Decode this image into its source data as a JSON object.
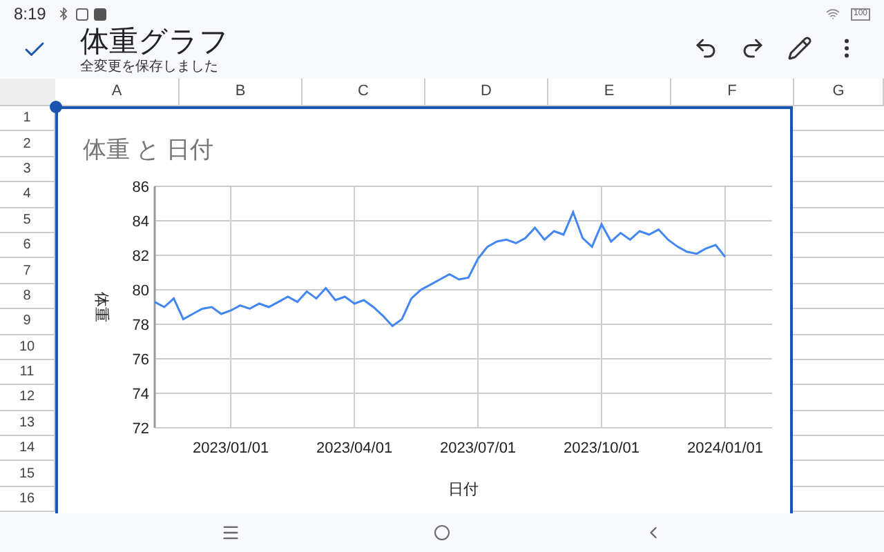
{
  "status_bar": {
    "time": "8:19",
    "battery": "100"
  },
  "toolbar": {
    "title": "体重グラフ",
    "subtitle": "全変更を保存しました"
  },
  "columns": [
    "A",
    "B",
    "C",
    "D",
    "E",
    "F",
    "G"
  ],
  "rows": [
    "1",
    "2",
    "3",
    "4",
    "5",
    "6",
    "7",
    "8",
    "9",
    "10",
    "11",
    "12",
    "13",
    "14",
    "15",
    "16"
  ],
  "chart": {
    "chart_data": {
      "type": "line",
      "title": "体重 と 日付",
      "xlabel": "日付",
      "ylabel": "体重",
      "categories": [
        null,
        null,
        null,
        null,
        null,
        null,
        null,
        null,
        "2023/01/01",
        null,
        null,
        null,
        null,
        null,
        null,
        null,
        null,
        null,
        null,
        null,
        null,
        "2023/04/01",
        null,
        null,
        null,
        null,
        null,
        null,
        null,
        null,
        null,
        null,
        null,
        null,
        "2023/07/01",
        null,
        null,
        null,
        null,
        null,
        null,
        null,
        null,
        null,
        null,
        null,
        null,
        "2023/10/01",
        null,
        null,
        null,
        null,
        null,
        null,
        null,
        null,
        null,
        null,
        null,
        null,
        "2024/01/01"
      ],
      "grid": true,
      "series": [
        {
          "color": "#4285f4",
          "values": [
            79.3,
            79.0,
            79.5,
            78.3,
            78.6,
            78.9,
            79.0,
            78.6,
            78.8,
            79.1,
            78.9,
            79.2,
            79.0,
            79.3,
            79.6,
            79.3,
            79.9,
            79.5,
            80.1,
            79.4,
            79.6,
            79.2,
            79.4,
            79.0,
            78.5,
            77.9,
            78.3,
            79.5,
            80.0,
            80.3,
            80.6,
            80.9,
            80.6,
            80.7,
            81.8,
            82.5,
            82.8,
            82.9,
            82.7,
            83.0,
            83.6,
            82.9,
            83.4,
            83.2,
            84.5,
            83.0,
            82.5,
            83.8,
            82.8,
            83.3,
            82.9,
            83.4,
            83.2,
            83.5,
            82.9,
            82.5,
            82.2,
            82.1,
            82.4,
            82.6,
            81.9
          ]
        }
      ],
      "ylim": [
        72,
        86
      ],
      "yticks": [
        72,
        74,
        76,
        78,
        80,
        82,
        84,
        86
      ]
    }
  }
}
